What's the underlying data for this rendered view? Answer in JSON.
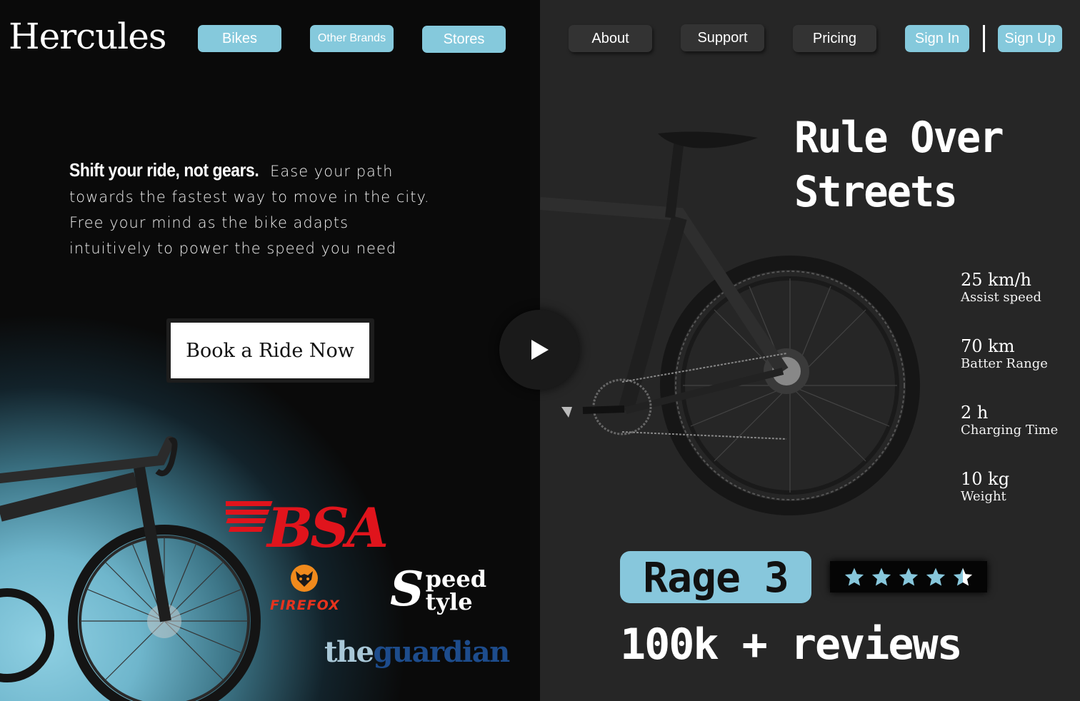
{
  "brand": {
    "logo": "Hercules"
  },
  "nav": {
    "bikes": "Bikes",
    "other_brands": "Other Brands",
    "stores": "Stores",
    "about": "About",
    "support": "Support",
    "pricing": "Pricing",
    "sign_in": "Sign In",
    "sign_up": "Sign Up"
  },
  "hero": {
    "tagline_bold": "Shift your ride, not gears.",
    "tagline_rest": "Ease your path towards the fastest way to move in the city. Free your mind as the bike adapts intuitively to power the speed you need",
    "cta": "Book a Ride Now",
    "headline_line1": "Rule Over",
    "headline_line2": "Streets"
  },
  "partners": {
    "bsa": "BSA",
    "firefox": "FIREFOX",
    "speed_initial": "S",
    "speed_line1": "peed",
    "speed_line2": "tyle",
    "guardian_the": "the",
    "guardian_name": "guardian"
  },
  "specs": [
    {
      "value": "25 km/h",
      "label": "Assist speed"
    },
    {
      "value": "70 km",
      "label": "Batter Range"
    },
    {
      "value": "2 h",
      "label": "Charging Time"
    },
    {
      "value": "10 kg",
      "label": "Weight"
    }
  ],
  "model": {
    "name": "Rage 3",
    "rating": 4.5,
    "rating_max": 5,
    "reviews": "100k + reviews"
  },
  "colors": {
    "accent": "#85c9dc",
    "dark_panel": "#262626",
    "bsa_red": "#e0141c"
  }
}
